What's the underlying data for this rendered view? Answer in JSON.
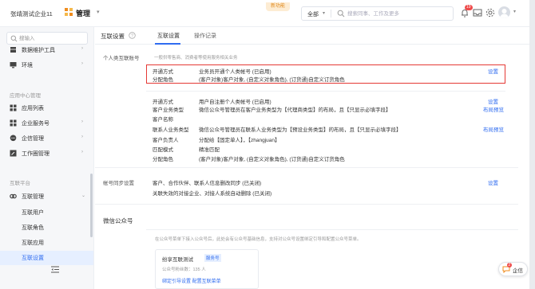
{
  "topbar": {
    "company": "张靖测试企业11",
    "app_title": "管理",
    "new_feature_badge": "新功能",
    "search_scope": "全部",
    "search_placeholder": "搜索同事、工作及更多",
    "notification_count": "19"
  },
  "sidebar": {
    "search_placeholder": "搜输入",
    "top_items": [
      {
        "label": "数据维护工具",
        "icon": "database-icon"
      },
      {
        "label": "环境",
        "icon": "monitor-icon"
      }
    ],
    "group_app_center": "应用中心管理",
    "app_items": [
      {
        "label": "应用列表",
        "icon": "grid-icon"
      },
      {
        "label": "企业服务号",
        "icon": "grid-icon"
      },
      {
        "label": "企信管理",
        "icon": "chat-icon"
      },
      {
        "label": "工作圈管理",
        "icon": "edit-icon"
      }
    ],
    "group_interconnect": "互联平台",
    "interconnect_item": "互联管理",
    "sub_items": [
      "互联用户",
      "互联角色",
      "互联应用",
      "互联设置"
    ]
  },
  "main": {
    "title": "互联设置",
    "tabs": [
      "互联设置",
      "操作记录"
    ],
    "personal_account": {
      "label": "个人类互联账号",
      "desc": "一般供零售商、消费者等使用服务相关业务",
      "block1": {
        "k1": "开通方式",
        "v1": "业务员开通个人类帐号 (已启用)",
        "k2": "分配角色",
        "v2": "(客户对象)客户对象, (自定义对象角色), (订货通)自定义订货角色",
        "action": "设置"
      },
      "block2": {
        "rows": [
          {
            "k": "开通方式",
            "v": "用户自注册个人类帐号 (已启用)"
          },
          {
            "k": "客户业务类型",
            "v": "微信公众号管理员在客户业务类型为【代理商类型】的布局，且【只显示必填字段】"
          },
          {
            "k": "客户名称",
            "v": ""
          },
          {
            "k": "联系人业务类型",
            "v": "微信公众号管理员在联系人业务类型为【预设业务类型】的布局，且【只显示必填字段】"
          },
          {
            "k": "客户负责人",
            "v": "分配给【固定单人】，【zhangjuan】"
          },
          {
            "k": "匹配模式",
            "v": "精准匹配"
          },
          {
            "k": "分配角色",
            "v": "(客户对象)客户对象, (自定义对象角色), (订货通)自定义订货角色"
          }
        ],
        "actions": [
          "设置",
          "布局预览",
          "布局预览"
        ]
      }
    },
    "account_sync": {
      "label": "帐号同步设置",
      "line1": "客户、合作伙伴、联系人信息删改同步 (已关闭)",
      "line2": "关联失效的对接企业、对接人系统自动删除 (已关闭)",
      "action": "设置"
    },
    "wechat": {
      "label": "微信公众号",
      "desc": "在公众号菜单下接入公众号后，此处会有公众号基础信息，支持对公众号设置绑定引导和配置公众号菜单。",
      "card_name": "纷享互联测试",
      "card_tag": "服务号",
      "card_count": "公众号粉丝数：135 人",
      "card_links": "绑定引导设置  配置互联菜单"
    }
  },
  "float_button": {
    "label": "企信",
    "badge": "2"
  }
}
